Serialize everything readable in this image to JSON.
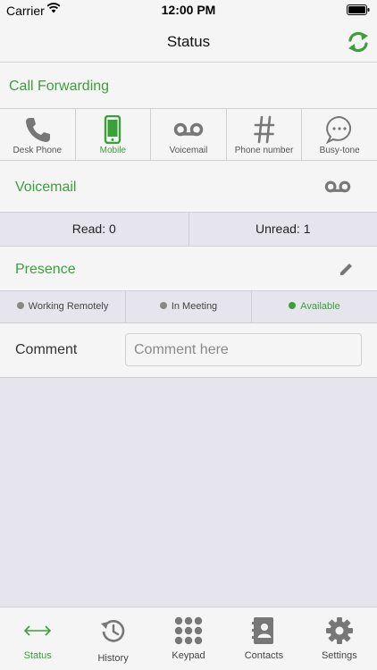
{
  "status_bar": {
    "carrier": "Carrier",
    "time": "12:00 PM"
  },
  "nav": {
    "title": "Status",
    "refresh_icon": "refresh-icon"
  },
  "call_forwarding": {
    "title": "Call Forwarding",
    "options": [
      {
        "label": "Desk Phone",
        "icon": "phone-icon",
        "active": false
      },
      {
        "label": "Mobile",
        "icon": "mobile-icon",
        "active": true
      },
      {
        "label": "Voicemail",
        "icon": "voicemail-icon",
        "active": false
      },
      {
        "label": "Phone number",
        "icon": "hash-icon",
        "active": false
      },
      {
        "label": "Busy-tone",
        "icon": "speech-bubble-icon",
        "active": false
      }
    ]
  },
  "voicemail": {
    "title": "Voicemail",
    "read_label": "Read: 0",
    "unread_label": "Unread: 1"
  },
  "presence": {
    "title": "Presence",
    "edit_icon": "pencil-icon",
    "options": [
      {
        "label": "Working Remotely",
        "active": false
      },
      {
        "label": "In Meeting",
        "active": false
      },
      {
        "label": "Available",
        "active": true
      }
    ]
  },
  "comment": {
    "label": "Comment",
    "placeholder": "Comment here",
    "value": ""
  },
  "tab_bar": {
    "tabs": [
      {
        "label": "Status",
        "icon": "arrows-horizontal-icon",
        "active": true
      },
      {
        "label": "History",
        "icon": "history-icon",
        "active": false
      },
      {
        "label": "Keypad",
        "icon": "keypad-icon",
        "active": false
      },
      {
        "label": "Contacts",
        "icon": "contacts-book-icon",
        "active": false
      },
      {
        "label": "Settings",
        "icon": "gear-icon",
        "active": false
      }
    ]
  },
  "colors": {
    "accent": "#3aa03a",
    "icon_gray": "#777777",
    "background": "#e6e5ed",
    "panel": "#f6f5f5"
  }
}
